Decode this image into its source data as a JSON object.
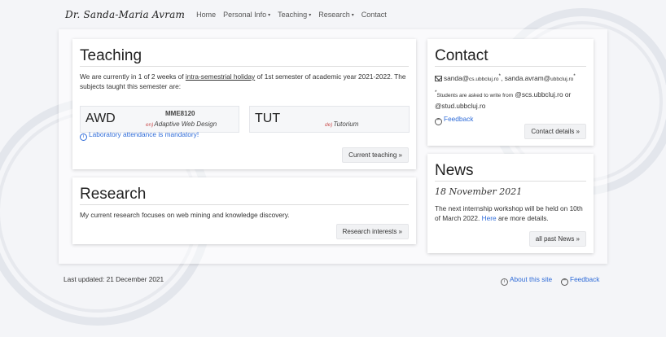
{
  "nav": {
    "brand": "Dr. Sanda-Maria Avram",
    "items": [
      {
        "label": "Home"
      },
      {
        "label": "Personal Info",
        "caret": "▾"
      },
      {
        "label": "Teaching",
        "caret": "▾"
      },
      {
        "label": "Research",
        "caret": "▾"
      },
      {
        "label": "Contact"
      }
    ]
  },
  "teaching": {
    "title": "Teaching",
    "intro_1": "We are currently in 1 of 2 weeks of ",
    "intro_link": "intra-semestrial holiday",
    "intro_2": " of 1st semester of academic year 2021-2022. The subjects taught this semester are:",
    "courses": [
      {
        "code": "AWD",
        "id": "MME8120",
        "lang": "en)",
        "name": "Adaptive Web Design"
      },
      {
        "code": "TUT",
        "id": "",
        "lang": "de)",
        "name": "Tutorium"
      }
    ],
    "notice": "Laboratory attendance is mandatory!",
    "button": "Current teaching »"
  },
  "research": {
    "title": "Research",
    "text": "My current research focuses on web mining and knowledge discovery.",
    "button": "Research interests »"
  },
  "contact": {
    "title": "Contact",
    "email1_user": "sanda",
    "email1_domain": "cs.ubbcluj.ro",
    "email2_user": "sanda.avram",
    "email2_domain": "ubbcluj.ro",
    "at": "@",
    "star": "*",
    "sep": ", ",
    "note_small": "Students are asked to write from",
    "note_rest": " @scs.ubbcluj.ro or @stud.ubbcluj.ro",
    "feedback": "Feedback",
    "button": "Contact details »"
  },
  "news": {
    "title": "News",
    "date": "18 November 2021",
    "text_1": "The next internship workshop will be held on 10th of March 2022. ",
    "link": "Here",
    "text_2": " are more details.",
    "button": "all past News »"
  },
  "footer": {
    "updated": "Last updated: 21 December 2021",
    "about": "About this site",
    "feedback": "Feedback"
  },
  "icons": {
    "info": "i",
    "quote": "❞"
  }
}
